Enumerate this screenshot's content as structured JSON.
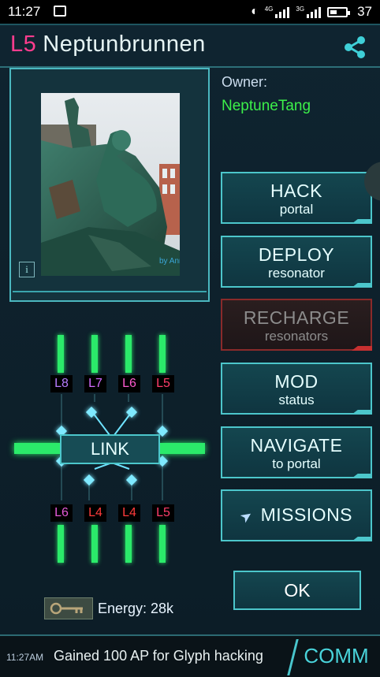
{
  "status_bar": {
    "time": "11:27",
    "signal1_label": "4G",
    "signal2_label": "3G",
    "battery": "37"
  },
  "portal": {
    "level": "L5",
    "name": "Neptunbrunnen",
    "photo_credit": "by Anne",
    "owner_label": "Owner:",
    "owner_name": "NeptuneTang"
  },
  "buttons": {
    "hack": {
      "main": "HACK",
      "sub": "portal"
    },
    "deploy": {
      "main": "DEPLOY",
      "sub": "resonator"
    },
    "recharge": {
      "main": "RECHARGE",
      "sub": "resonators"
    },
    "mod": {
      "main": "MOD",
      "sub": "status"
    },
    "navigate": {
      "main": "NAVIGATE",
      "sub": "to portal"
    },
    "missions": {
      "main": "MISSIONS"
    },
    "ok": "OK",
    "link": "LINK"
  },
  "resonators": {
    "top": [
      "L8",
      "L7",
      "L6",
      "L5"
    ],
    "bottom": [
      "L6",
      "L4",
      "L4",
      "L5"
    ]
  },
  "energy": "Energy: 28k",
  "comm": {
    "timestamp": "11:27AM",
    "message": "Gained 100 AP for Glyph hacking",
    "label": "COMM"
  },
  "colors": {
    "level_pink": "#ff3d8e",
    "owner_green": "#3cf04a",
    "resonator_green": "#2bea6a",
    "accent_cyan": "#4cc6cb"
  }
}
